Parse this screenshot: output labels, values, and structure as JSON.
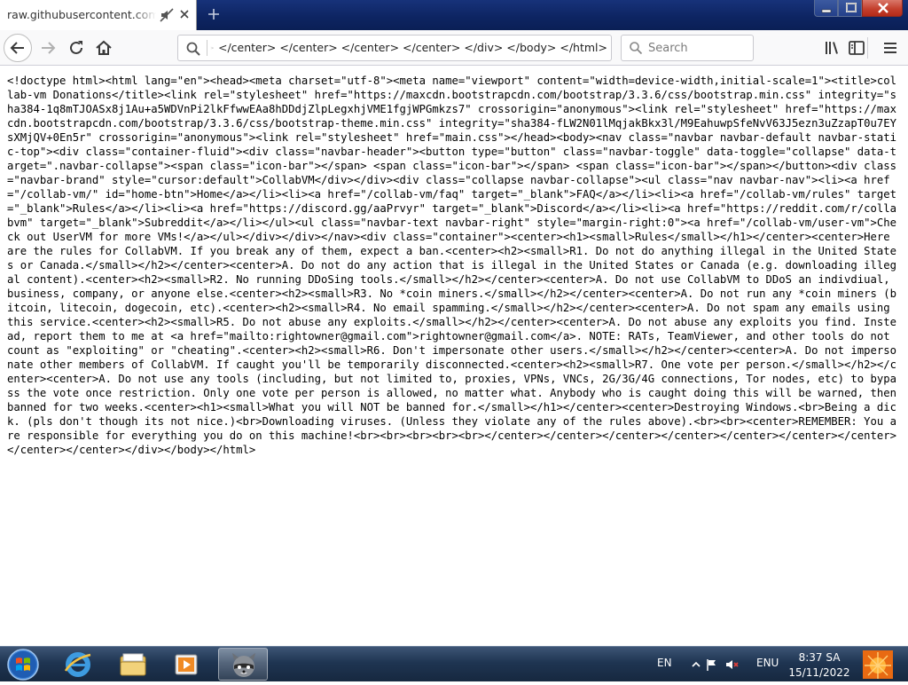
{
  "browser": {
    "tab": {
      "title": "raw.githubusercontent.com/ano"
    },
    "url": "enter> </center> </center> </center> </center> </div> </body> </html>",
    "search": {
      "placeholder": "Search"
    }
  },
  "page": {
    "source_html": "<!doctype html><html lang=\"en\"><head><meta charset=\"utf-8\"><meta name=\"viewport\" content=\"width=device-width,initial-scale=1\"><title>collab-vm Donations</title><link rel=\"stylesheet\" href=\"https://maxcdn.bootstrapcdn.com/bootstrap/3.3.6/css/bootstrap.min.css\" integrity=\"sha384-1q8mTJOASx8j1Au+a5WDVnPi2lkFfwwEAa8hDDdjZlpLegxhjVME1fgjWPGmkzs7\" crossorigin=\"anonymous\"><link rel=\"stylesheet\" href=\"https://maxcdn.bootstrapcdn.com/bootstrap/3.3.6/css/bootstrap-theme.min.css\" integrity=\"sha384-fLW2N01lMqjakBkx3l/M9EahuwpSfeNvV63J5ezn3uZzapT0u7EYsXMjQV+0En5r\" crossorigin=\"anonymous\"><link rel=\"stylesheet\" href=\"main.css\"></head><body><nav class=\"navbar navbar-default navbar-static-top\"><div class=\"container-fluid\"><div class=\"navbar-header\"><button type=\"button\" class=\"navbar-toggle\" data-toggle=\"collapse\" data-target=\".navbar-collapse\"><span class=\"icon-bar\"></span> <span class=\"icon-bar\"></span> <span class=\"icon-bar\"></span></button><div class=\"navbar-brand\" style=\"cursor:default\">CollabVM</div></div><div class=\"collapse navbar-collapse\"><ul class=\"nav navbar-nav\"><li><a href=\"/collab-vm/\" id=\"home-btn\">Home</a></li><li><a href=\"/collab-vm/faq\" target=\"_blank\">FAQ</a></li><li><a href=\"/collab-vm/rules\" target=\"_blank\">Rules</a></li><li><a href=\"https://discord.gg/aaPrvyr\" target=\"_blank\">Discord</a></li><li><a href=\"https://reddit.com/r/collabvm\" target=\"_blank\">Subreddit</a></li></ul><ul class=\"navbar-text navbar-right\" style=\"margin-right:0\"><a href=\"/collab-vm/user-vm\">Check out UserVM for more VMs!</a></ul></div></div></nav><div class=\"container\"><center><h1><small>Rules</small></h1></center><center>Here are the rules for CollabVM. If you break any of them, expect a ban.<center><h2><small>R1. Do not do anything illegal in the United States or Canada.</small></h2></center><center>A. Do not do any action that is illegal in the United States or Canada (e.g. downloading illegal content).<center><h2><small>R2. No running DDoSing tools.</small></h2></center><center>A. Do not use CollabVM to DDoS an indivdiual, business, company, or anyone else.<center><h2><small>R3. No *coin miners.</small></h2></center><center>A. Do not run any *coin miners (bitcoin, litecoin, dogecoin, etc).<center><h2><small>R4. No email spamming.</small></h2></center><center>A. Do not spam any emails using this service.<center><h2><small>R5. Do not abuse any exploits.</small></h2></center><center>A. Do not abuse any exploits you find. Instead, report them to me at <a href=\"mailto:rightowner@gmail.com\">rightowner@gmail.com</a>. NOTE: RATs, TeamViewer, and other tools do not count as \"exploiting\" or \"cheating\".<center><h2><small>R6. Don't impersonate other users.</small></h2></center><center>A. Do not impersonate other members of CollabVM. If caught you'll be temporarily disconnected.<center><h2><small>R7. One vote per person.</small></h2></center><center>A. Do not use any tools (including, but not limited to, proxies, VPNs, VNCs, 2G/3G/4G connections, Tor nodes, etc) to bypass the vote once restriction. Only one vote per person is allowed, no matter what. Anybody who is caught doing this will be warned, then banned for two weeks.<center><h1><small>What you will NOT be banned for.</small></h1></center><center>Destroying Windows.<br>Being a dick. (pls don't though its not nice.)<br>Downloading viruses. (Unless they violate any of the rules above).<br><br><center>REMEMBER: You are responsible for everything you do on this machine!<br><br><br><br><br></center></center></center></center></center></center></center></center></center></div></body></html>"
  },
  "taskbar": {
    "pinned": [
      "start-button",
      "internet-explorer",
      "windows-explorer",
      "media-player",
      "firefox-collabvm"
    ],
    "active": "firefox-collabvm"
  },
  "tray": {
    "language": "EN",
    "keyboard": "ENU",
    "time": "8:37 SA",
    "date": "15/11/2022"
  },
  "colors": {
    "titlebar": "#0d2461",
    "taskbar": "#1f3552",
    "close_button": "#c4402e"
  }
}
